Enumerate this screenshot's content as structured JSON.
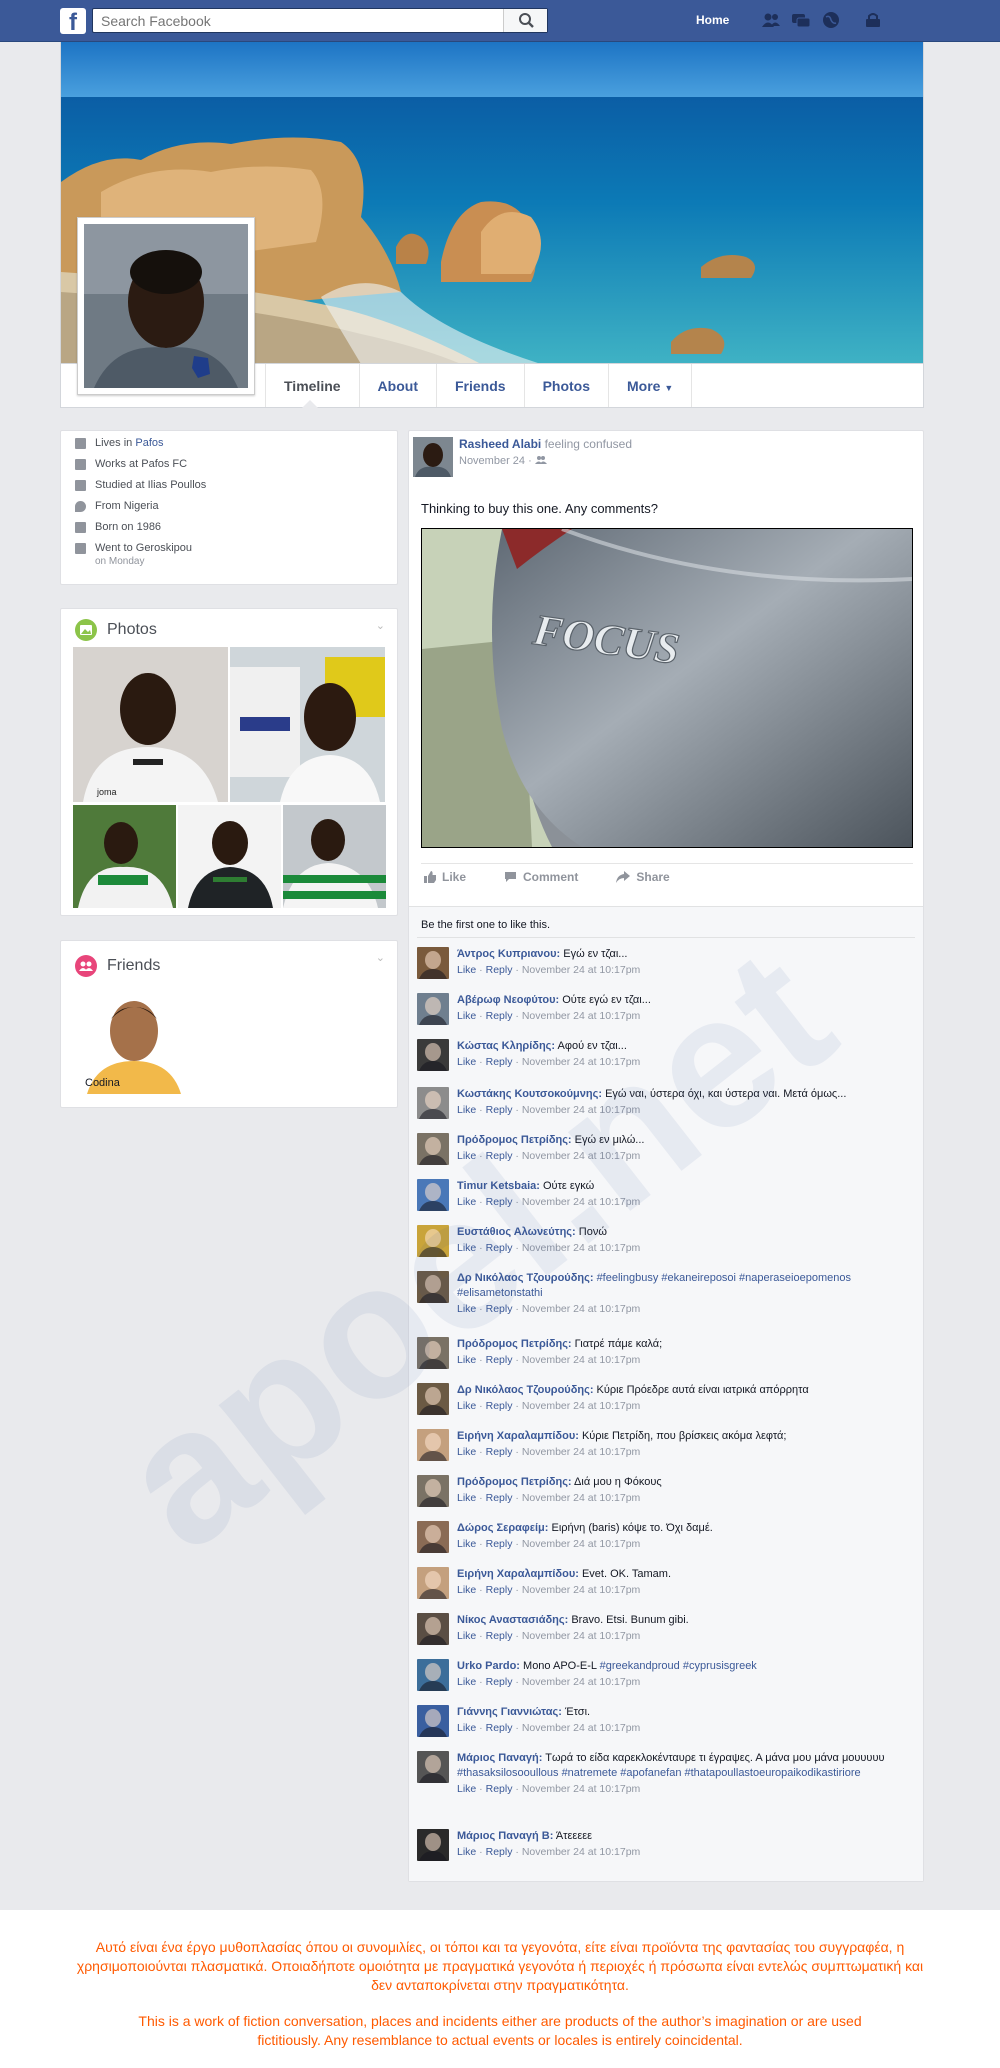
{
  "topbar": {
    "search_placeholder": "Search Facebook",
    "home_label": "Home",
    "icons": [
      "friends-icon",
      "messages-icon",
      "globe-icon",
      "lock-icon"
    ]
  },
  "profile": {
    "nav_tabs": [
      "Timeline",
      "About",
      "Friends",
      "Photos",
      "More"
    ]
  },
  "intro": {
    "lives_prefix": "Lives in ",
    "lives_place": "Pafos",
    "works": "Works at Pafos FC",
    "studied": "Studied at Ilias Poullos",
    "from": "From Nigeria",
    "born": "Born on 1986",
    "went": "Went to Geroskipou",
    "went_when": "on Monday"
  },
  "photos_title": "Photos",
  "friends_card": {
    "title": "Friends",
    "friend_name": "Codina"
  },
  "post": {
    "author": "Rasheed Alabi",
    "feeling": "feeling confused",
    "date": "November 24 ·",
    "text": "Thinking to buy this one. Any comments?",
    "car_badge": "FOCUS",
    "actions": {
      "like": "Like",
      "comment": "Comment",
      "share": "Share"
    },
    "likes_text": "Be the first one to like this."
  },
  "comments": [
    {
      "name": "Άντρος Κυπριανου:",
      "text": " Εγώ εν τζαι...",
      "meta": "November 24 at 10:17pm",
      "color": "#7a5a3c"
    },
    {
      "name": "Αβέρωφ Νεοφύτου:",
      "text": " Ούτε εγώ εν τζαι...",
      "meta": "November 24 at 10:17pm",
      "color": "#6f7f8f"
    },
    {
      "name": "Κώστας Κληρίδης:",
      "text": " Αφού εν τζαι...",
      "meta": "November 24 at 10:17pm",
      "color": "#3a3a3a"
    },
    {
      "name": "Κωστάκης Κουτσοκούμνης:",
      "text": " Εγώ ναι, ύστερα όχι, και ύστερα ναι. Μετά όμως...",
      "meta": "November 24 at 10:17pm",
      "color": "#8c8c8c"
    },
    {
      "name": "Πρόδρομος Πετρίδης:",
      "text": " Εγώ εν μιλώ...",
      "meta": "November 24 at 10:17pm",
      "color": "#7a7265"
    },
    {
      "name": "Timur Ketsbaia:",
      "text": " Ούτε εγκώ",
      "meta": "November 24 at 10:17pm",
      "color": "#4a78b8"
    },
    {
      "name": "Ευστάθιος Αλωνεύτης:",
      "text": " Πονώ",
      "meta": "November 24 at 10:17pm",
      "color": "#c9a43a"
    },
    {
      "name": "Δρ Νικόλαος Τζουρούδης:",
      "text": " ",
      "tags": "#feelingbusy #ekaneireposoi #naperaseioepomenos #elisametonstathi",
      "meta": "November 24 at 10:17pm",
      "color": "#6b5a44"
    },
    {
      "name": "Πρόδρομος Πετρίδης:",
      "text": " Γιατρέ πάμε καλά;",
      "meta": "November 24 at 10:17pm",
      "color": "#7a7265"
    },
    {
      "name": "Δρ Νικόλαος Τζουρούδης:",
      "text": " Κύριε Πρόεδρε αυτά είναι ιατρικά απόρρητα",
      "meta": "November 24 at 10:17pm",
      "color": "#6b5a44"
    },
    {
      "name": "Ειρήνη Χαραλαμπίδου:",
      "text": " Κύριε Πετρίδη, που βρίσκεις ακόμα λεφτά;",
      "meta": "November 24 at 10:17pm",
      "color": "#c4a07e"
    },
    {
      "name": "Πρόδρομος Πετρίδης:",
      "text": " Διά μου η Φόκους",
      "meta": "November 24 at 10:17pm",
      "color": "#7a7265"
    },
    {
      "name": "Δώρος Σεραφείμ:",
      "text": " Ειρήνη (baris) κόψε το. Όχι δαμέ.",
      "meta": "November 24 at 10:17pm",
      "color": "#8a6b55"
    },
    {
      "name": "Ειρήνη Χαραλαμπίδου:",
      "text": " Evet. OK. Tamam.",
      "meta": "November 24 at 10:17pm",
      "color": "#c4a07e"
    },
    {
      "name": "Νίκος Αναστασιάδης:",
      "text": " Bravo. Etsi. Bunum gibi.",
      "meta": "November 24 at 10:17pm",
      "color": "#5a4e44"
    },
    {
      "name": "Urko Pardo:",
      "text": " Mono APO-E-L ",
      "tags": "#greekandproud #cyprusisgreek",
      "meta": "November 24 at 10:17pm",
      "color": "#3c6e9a"
    },
    {
      "name": "Γιάννης Γιαννιώτας:",
      "text": " Έτσι.",
      "meta": "November 24 at 10:17pm",
      "color": "#3a5fa0"
    },
    {
      "name": "Μάριος Παναγή:",
      "text": " Τωρά το είδα καρεκλοκένταυρε τι έγραψες. Α μάνα μου μάνα μουυυυυ ",
      "tags": "#thasaksilosooullous #natremete #apofanefan #thatapoullastoeuropaikodikastiriore",
      "meta": "November 24 at 10:17pm",
      "color": "#555555"
    },
    {
      "name": "Μάριος Παναγή Β:",
      "text": " Άτεεεεε",
      "meta": "November 24 at 10:17pm",
      "color": "#2a2a2a"
    }
  ],
  "comment_like": "Like",
  "comment_reply": "Reply",
  "watermark": "apoel.net",
  "disclaimer": {
    "greek": "Αυτό είναι ένα έργο μυθοπλασίας όπου οι συνομιλίες, οι τόποι και τα γεγονότα, είτε είναι προϊόντα της φαντασίας του συγγραφέα, η χρησιμοποιούνται πλασματικά. Οποιαδήποτε ομοιότητα με πραγματικά γεγονότα ή περιοχές ή πρόσωπα είναι εντελώς συμπτωματική και δεν ανταποκρίνεται στην πραγματικότητα.",
    "english": "This is a work of fiction conversation, places and incidents either are products of the author’s imagination or are used fictitiously. Any resemblance to actual events or locales is entirely coincidental."
  },
  "colors": {
    "brand": "#3b5998",
    "disclaimer": "#ff5a00"
  }
}
